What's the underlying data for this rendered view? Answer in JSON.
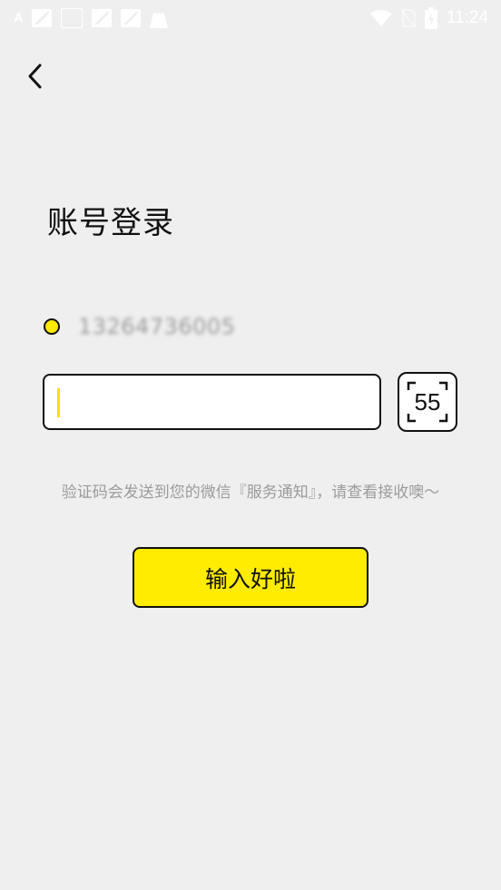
{
  "status_bar": {
    "time": "11:24",
    "icons": [
      "translate-icon",
      "image-icon",
      "news-icon",
      "image-icon",
      "image-icon",
      "bag-icon",
      "wifi-icon",
      "no-sim-icon",
      "battery-charging-icon"
    ]
  },
  "nav": {
    "back_icon": "chevron-left-icon"
  },
  "page": {
    "title": "账号登录"
  },
  "account": {
    "phone": "13264736005"
  },
  "verify": {
    "code_value": "",
    "countdown": "55"
  },
  "hint": "验证码会发送到您的微信『服务通知』，请查看接收噢～",
  "submit": {
    "label": "输入好啦"
  },
  "colors": {
    "accent_yellow": "#ffec00",
    "background": "#efefef",
    "text_dark": "#111111",
    "hint_gray": "#9b9b9b"
  }
}
